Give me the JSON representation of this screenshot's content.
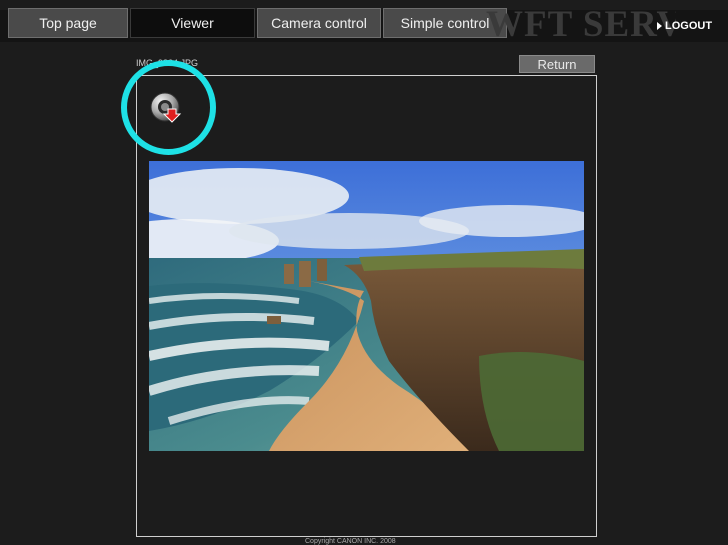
{
  "nav": {
    "tabs": [
      {
        "label": "Top page",
        "active": false
      },
      {
        "label": "Viewer",
        "active": true
      },
      {
        "label": "Camera control",
        "active": false
      },
      {
        "label": "Simple control",
        "active": false
      }
    ],
    "brand": "WFT SERVER",
    "logout": "LOGOUT"
  },
  "viewer": {
    "filename": "IMG_9824.JPG",
    "return_label": "Return",
    "download_icon": "download-icon",
    "photo_subject": "coastal cliffs and beach landscape",
    "highlight_color": "#1ee1e6"
  },
  "footer": {
    "copyright": "Copyright CANON INC. 2008"
  }
}
